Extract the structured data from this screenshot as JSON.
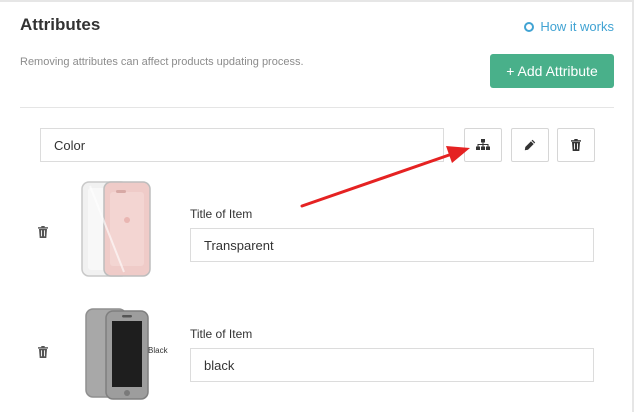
{
  "header": {
    "title": "Attributes",
    "help_link": "How it works",
    "description": "Removing attributes can affect products updating process.",
    "add_button": "+ Add Attribute"
  },
  "attribute": {
    "name": "Color",
    "actions": [
      "hierarchy-icon",
      "pencil-icon",
      "trash-icon"
    ]
  },
  "items": [
    {
      "label": "Title of Item",
      "value": "Transparent",
      "image_caption": ""
    },
    {
      "label": "Title of Item",
      "value": "black",
      "image_caption": "Black"
    }
  ],
  "colors": {
    "accent_green": "#49b08a",
    "link_blue": "#41a3d3",
    "annotation_arrow": "#e52222"
  }
}
